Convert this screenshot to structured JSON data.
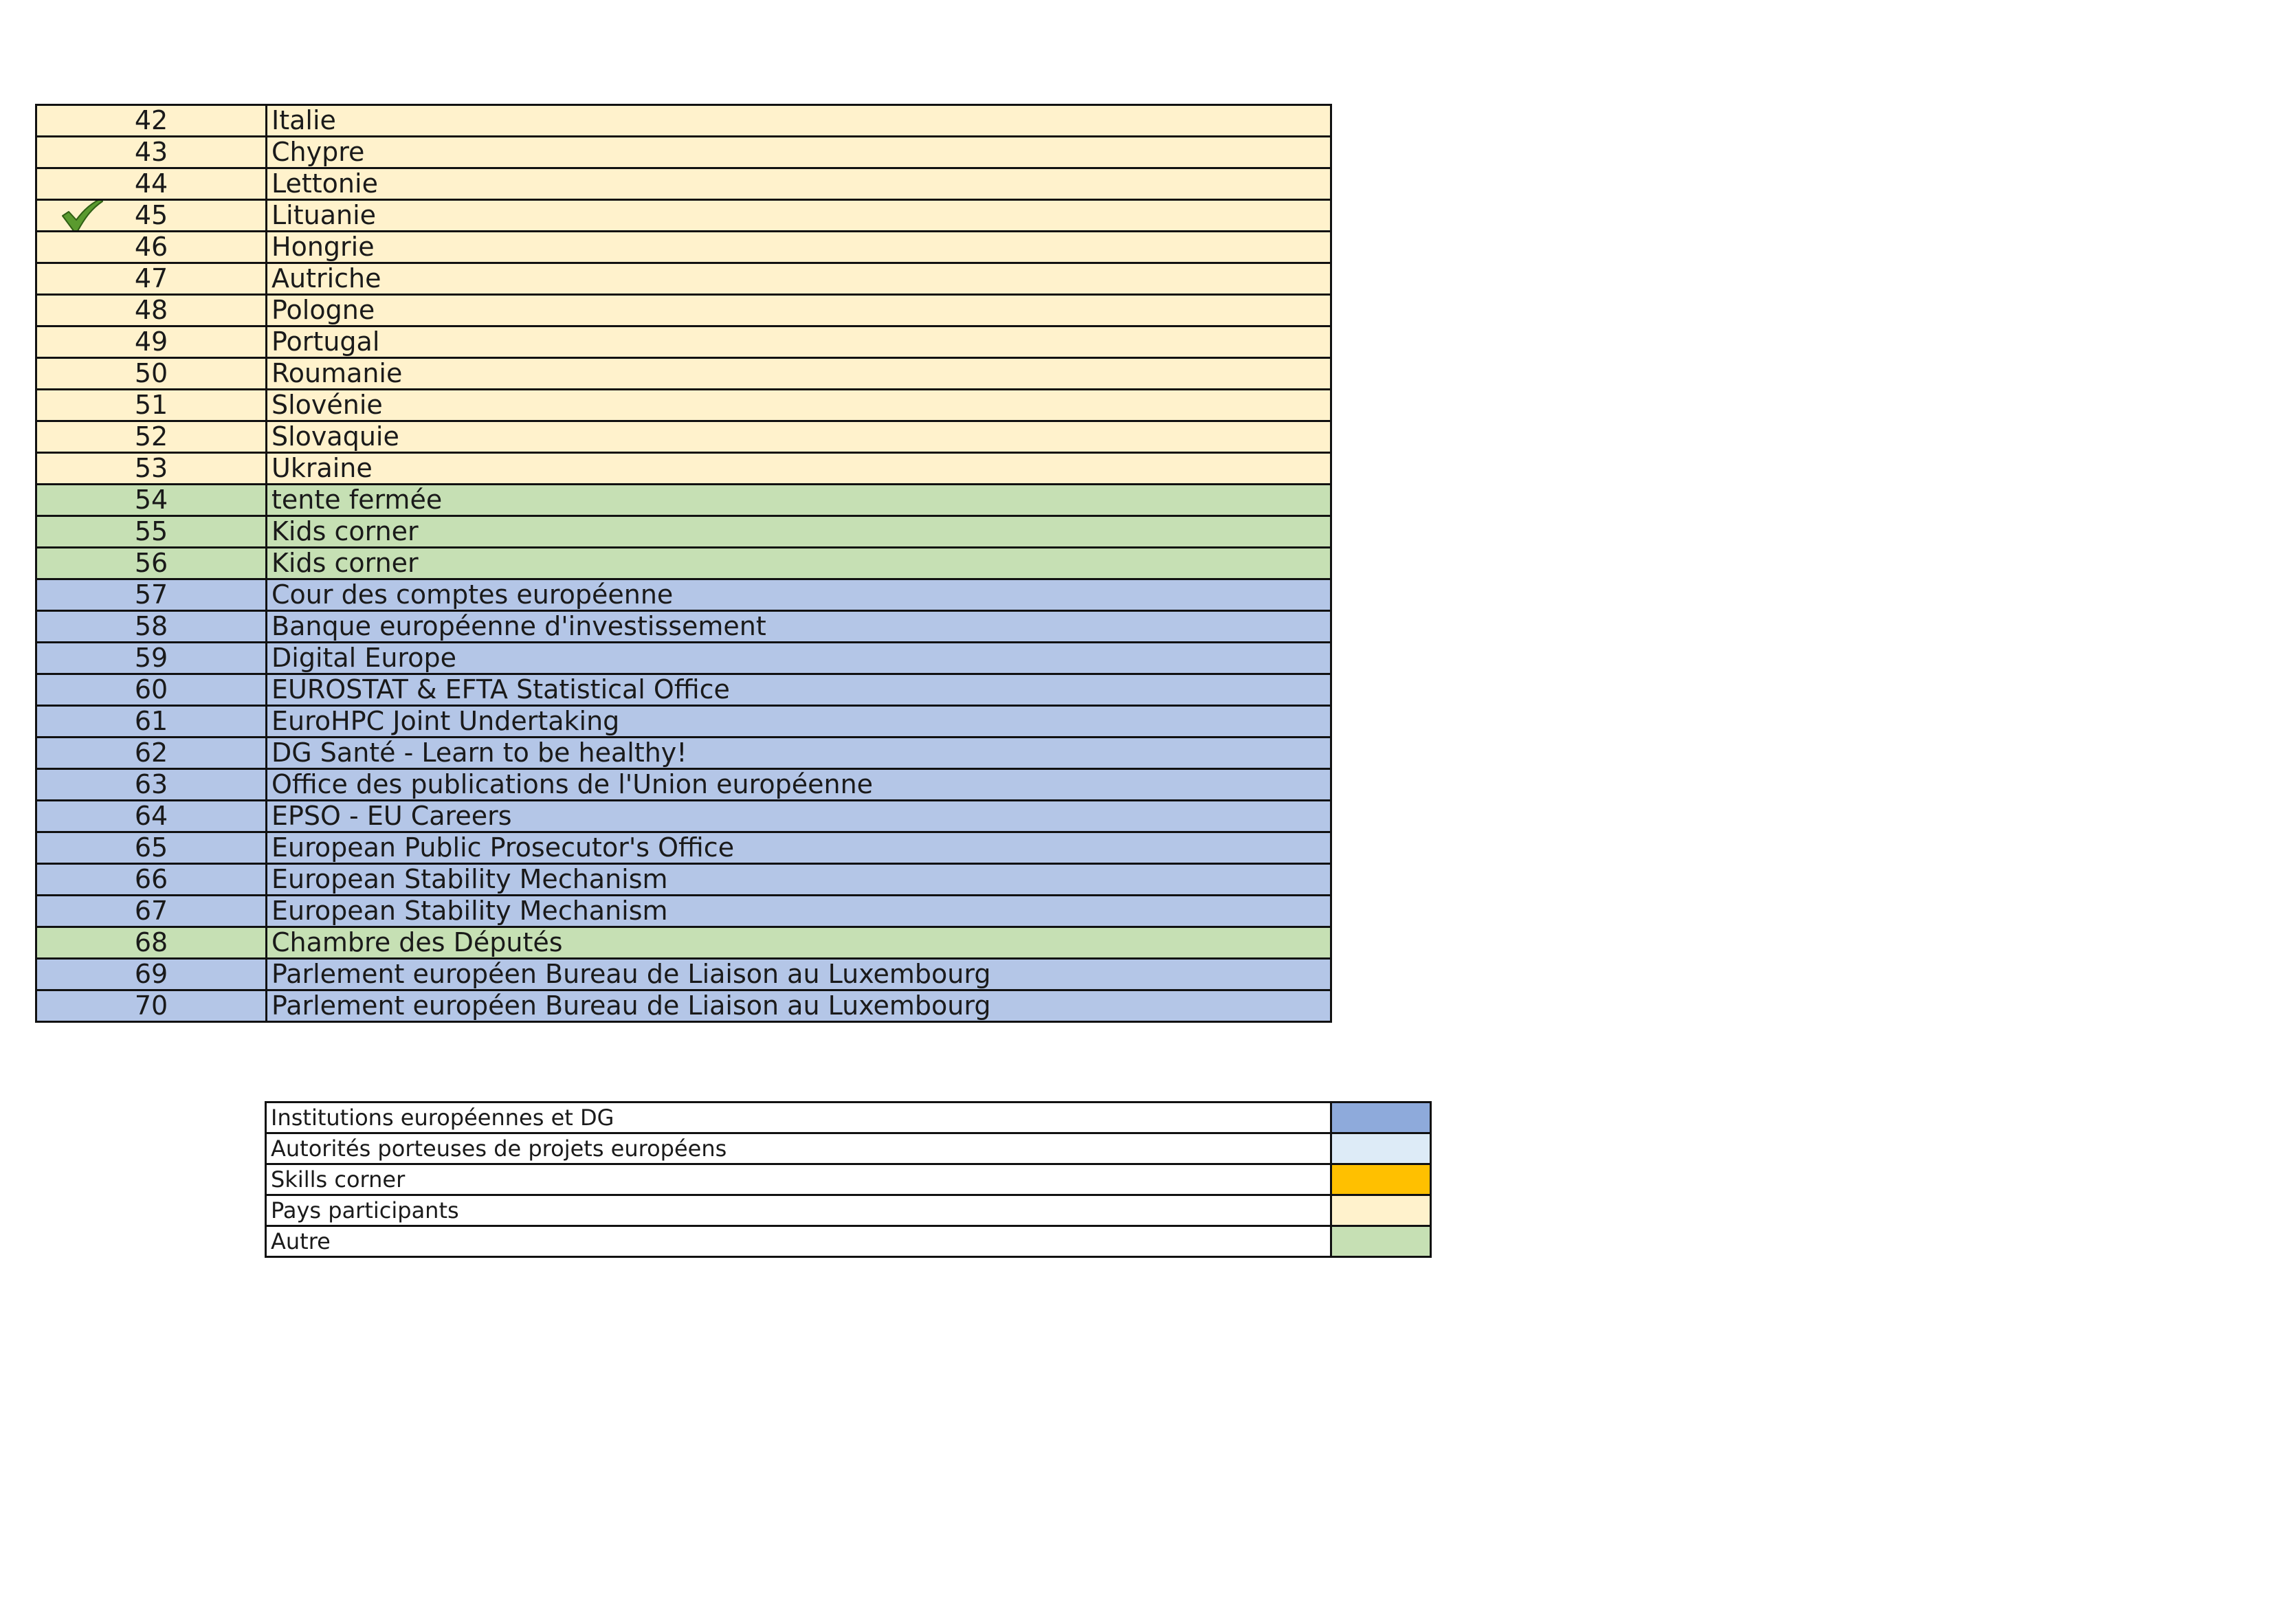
{
  "stands": [
    {
      "number": "42",
      "name": "Italie",
      "category": "pays",
      "checked": false
    },
    {
      "number": "43",
      "name": "Chypre",
      "category": "pays",
      "checked": false
    },
    {
      "number": "44",
      "name": "Lettonie",
      "category": "pays",
      "checked": false
    },
    {
      "number": "45",
      "name": "Lituanie",
      "category": "pays",
      "checked": true
    },
    {
      "number": "46",
      "name": "Hongrie",
      "category": "pays",
      "checked": false
    },
    {
      "number": "47",
      "name": "Autriche",
      "category": "pays",
      "checked": false
    },
    {
      "number": "48",
      "name": "Pologne",
      "category": "pays",
      "checked": false
    },
    {
      "number": "49",
      "name": "Portugal",
      "category": "pays",
      "checked": false
    },
    {
      "number": "50",
      "name": "Roumanie",
      "category": "pays",
      "checked": false
    },
    {
      "number": "51",
      "name": "Slovénie",
      "category": "pays",
      "checked": false
    },
    {
      "number": "52",
      "name": "Slovaquie",
      "category": "pays",
      "checked": false
    },
    {
      "number": "53",
      "name": "Ukraine",
      "category": "pays",
      "checked": false
    },
    {
      "number": "54",
      "name": "tente fermée",
      "category": "autre",
      "checked": false
    },
    {
      "number": "55",
      "name": "Kids corner",
      "category": "autre",
      "checked": false
    },
    {
      "number": "56",
      "name": "Kids corner",
      "category": "autre",
      "checked": false
    },
    {
      "number": "57",
      "name": "Cour des comptes européenne",
      "category": "inst",
      "checked": false
    },
    {
      "number": "58",
      "name": "Banque européenne d'investissement",
      "category": "inst",
      "checked": false
    },
    {
      "number": "59",
      "name": "Digital Europe",
      "category": "inst",
      "checked": false
    },
    {
      "number": "60",
      "name": "EUROSTAT & EFTA Statistical Office",
      "category": "inst",
      "checked": false
    },
    {
      "number": "61",
      "name": "EuroHPC Joint Undertaking",
      "category": "inst",
      "checked": false
    },
    {
      "number": "62",
      "name": "DG Santé - Learn to be healthy!",
      "category": "inst",
      "checked": false
    },
    {
      "number": "63",
      "name": "Office des publications de l'Union européenne",
      "category": "inst",
      "checked": false
    },
    {
      "number": "64",
      "name": "EPSO - EU Careers",
      "category": "inst",
      "checked": false
    },
    {
      "number": "65",
      "name": "European Public Prosecutor's Office",
      "category": "inst",
      "checked": false
    },
    {
      "number": "66",
      "name": "European Stability Mechanism",
      "category": "inst",
      "checked": false
    },
    {
      "number": "67",
      "name": "European Stability Mechanism",
      "category": "inst",
      "checked": false
    },
    {
      "number": "68",
      "name": "Chambre des Députés",
      "category": "autre",
      "checked": false
    },
    {
      "number": "69",
      "name": "Parlement européen  Bureau de Liaison au Luxembourg",
      "category": "inst",
      "checked": false
    },
    {
      "number": "70",
      "name": "Parlement européen  Bureau de Liaison au Luxembourg",
      "category": "inst",
      "checked": false
    }
  ],
  "legend": [
    {
      "label": "Institutions européennes et DG",
      "color": "#8eaadb"
    },
    {
      "label": "Autorités porteuses de projets européens",
      "color": "#ddebf7"
    },
    {
      "label": "Skills corner",
      "color": "#ffc000"
    },
    {
      "label": "Pays participants",
      "color": "#fff2cc"
    },
    {
      "label": "Autre",
      "color": "#c6e0b4"
    }
  ],
  "icons": {
    "check": "check-icon"
  }
}
